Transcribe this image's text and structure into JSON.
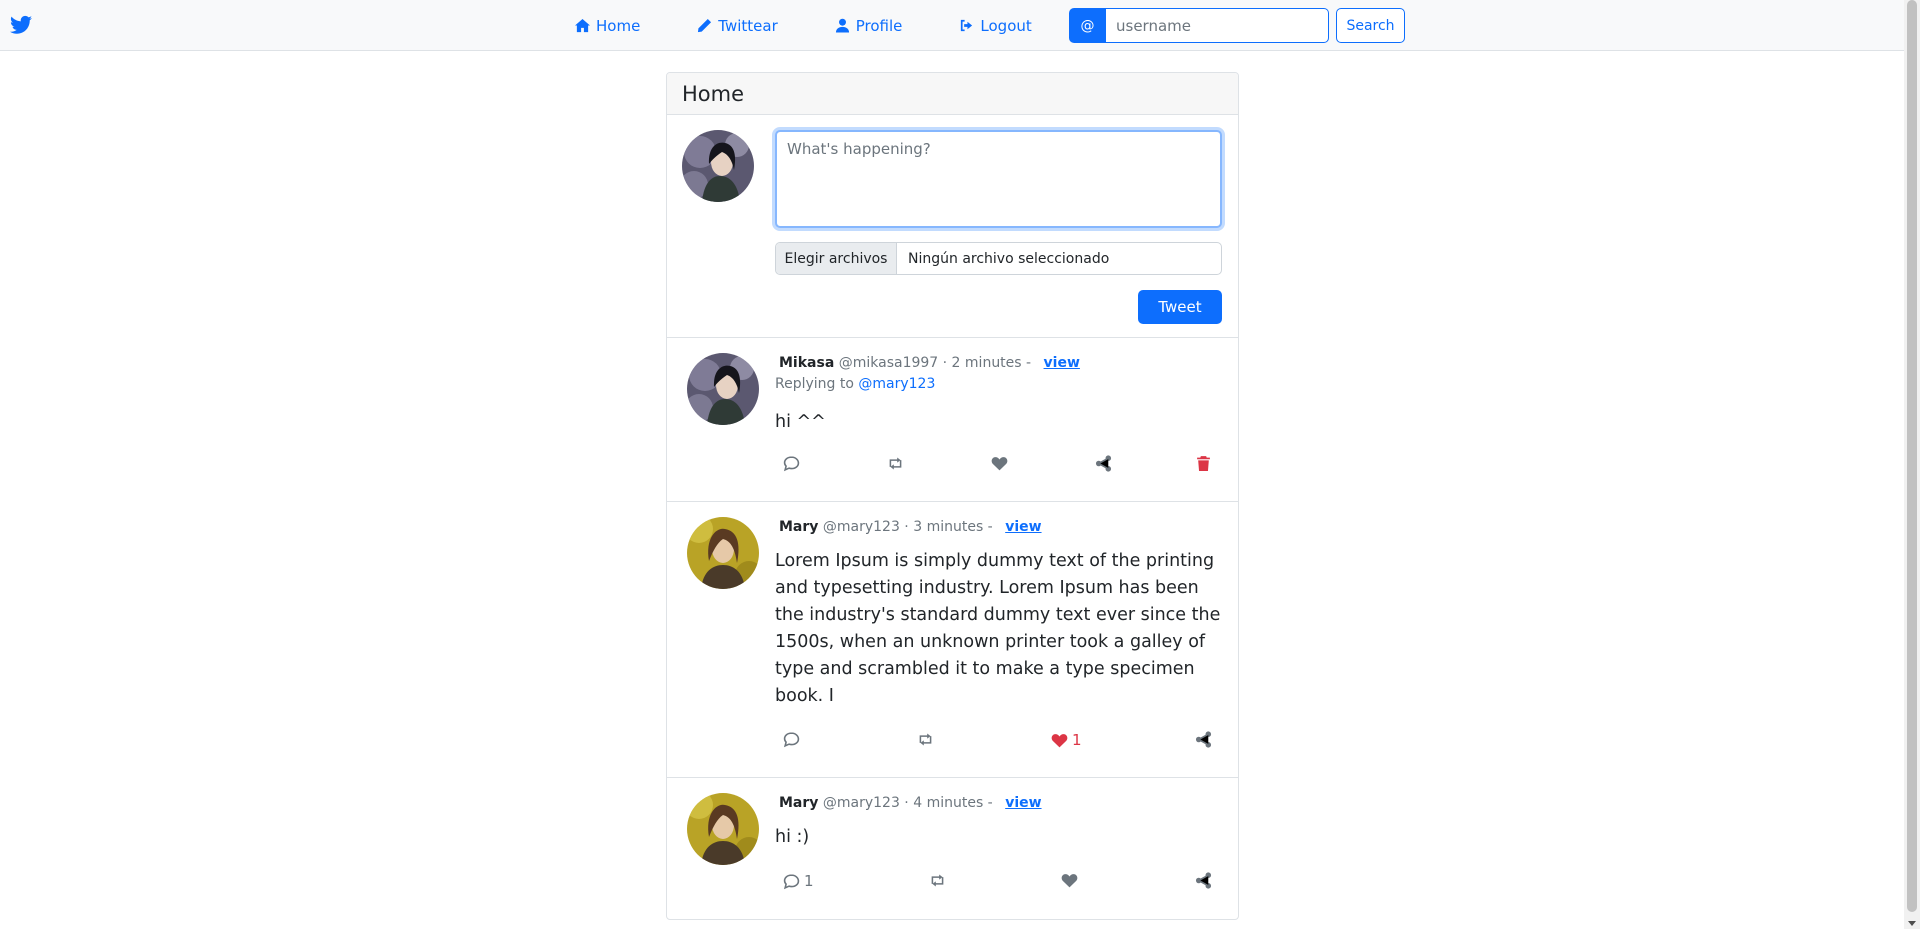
{
  "colors": {
    "primary": "#0d6efd",
    "danger": "#dc3545",
    "muted": "#6c757d"
  },
  "navbar": {
    "brand_icon": "twitter-bird-icon",
    "links": [
      {
        "label": "Home",
        "icon": "home-icon"
      },
      {
        "label": "Twittear",
        "icon": "pencil-icon"
      },
      {
        "label": "Profile",
        "icon": "user-icon"
      },
      {
        "label": "Logout",
        "icon": "logout-icon"
      }
    ],
    "search": {
      "prefix": "@",
      "placeholder": "username",
      "button": "Search"
    }
  },
  "card": {
    "title": "Home"
  },
  "compose": {
    "placeholder": "What's happening?",
    "file_button": "Elegir archivos",
    "file_status": "Ningún archivo seleccionado",
    "submit": "Tweet"
  },
  "tweets": [
    {
      "name": "Mikasa",
      "meta": "@mikasa1997 · 2 minutes -",
      "view": "view",
      "reply_prefix": "Replying to",
      "reply_to": "@mary123",
      "text": "hi ^^",
      "comments": "",
      "likes": "",
      "liked": false,
      "deletable": true
    },
    {
      "name": "Mary",
      "meta": "@mary123 · 3 minutes -",
      "view": "view",
      "text": "Lorem Ipsum is simply dummy text of the printing and typesetting industry. Lorem Ipsum has been the industry's standard dummy text ever since the 1500s, when an unknown printer took a galley of type and scrambled it to make a type specimen book. I",
      "comments": "",
      "likes": "1",
      "liked": true,
      "deletable": false
    },
    {
      "name": "Mary",
      "meta": "@mary123 · 4 minutes -",
      "view": "view",
      "text": "hi :)",
      "comments": "1",
      "likes": "",
      "liked": false,
      "deletable": false
    }
  ]
}
